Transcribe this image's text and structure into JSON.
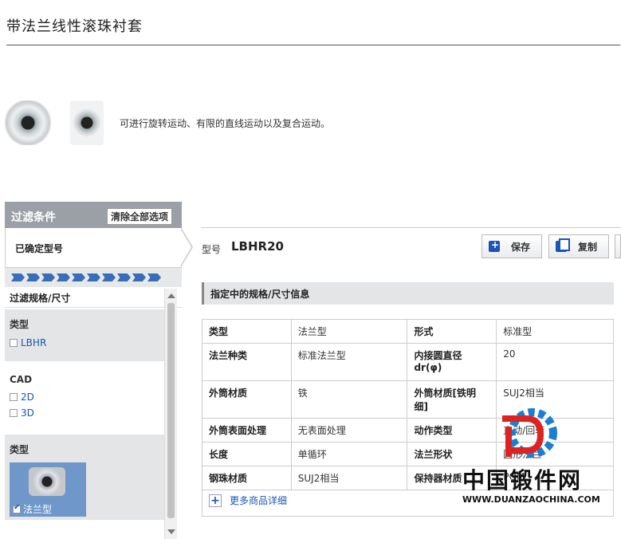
{
  "page": {
    "title": "带法兰线性滚珠衬套",
    "intro": "可进行旋转运动、有限的直线运动以及复合运动。"
  },
  "filter": {
    "header": "过滤条件",
    "clear_all": "清除全部选项",
    "confirmed_model": "已确定型号",
    "spec_title": "过滤规格/尺寸",
    "sections": [
      {
        "label": "类型",
        "options": [
          {
            "text": "LBHR",
            "checked": false
          }
        ]
      },
      {
        "label": "CAD",
        "options": [
          {
            "text": "2D",
            "checked": false
          },
          {
            "text": "3D",
            "checked": false
          }
        ]
      },
      {
        "label": "类型",
        "tile": {
          "text": "法兰型",
          "checked": true
        }
      }
    ]
  },
  "model": {
    "label": "型号",
    "value": "LBHR20"
  },
  "toolbar": {
    "save": "保存",
    "copy": "复制"
  },
  "spec": {
    "header": "指定中的规格/尺寸信息",
    "rows": [
      [
        "类型",
        "法兰型",
        "形式",
        "标准型"
      ],
      [
        "法兰种类",
        "标准法兰型",
        "内接圆直径\ndr(φ)",
        "20"
      ],
      [
        "外筒材质",
        "铁",
        "外筒材质[铁明细]",
        "SUJ2相当"
      ],
      [
        "外筒表面处理",
        "无表面处理",
        "动作类型",
        "直动/回转"
      ],
      [
        "长度",
        "单循环",
        "法兰形状",
        "圆形法兰"
      ],
      [
        "钢珠材质",
        "SUJ2相当",
        "保持器材质",
        "POM"
      ]
    ],
    "more": "更多商品详细"
  },
  "watermark": {
    "cn": "中国锻件网",
    "en": "WWW.DUANZAOCHINA.COM"
  },
  "colors": {
    "accent": "#1a55b5",
    "panel_header": "#9aa0a6",
    "tile": "#6f97c9"
  }
}
